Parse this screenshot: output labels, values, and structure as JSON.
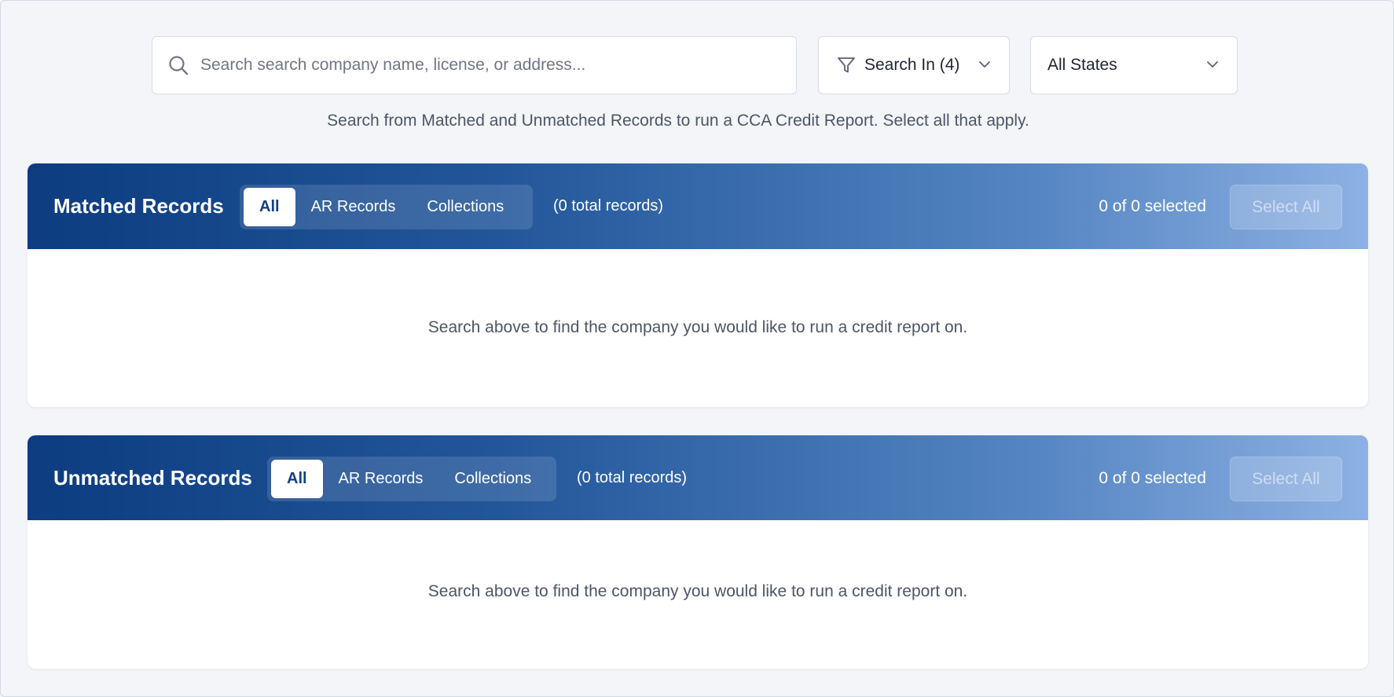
{
  "search": {
    "placeholder": "Search search company name, license, or address...",
    "value": ""
  },
  "filter": {
    "label": "Search In (4)",
    "icon": "filter-icon"
  },
  "state_select": {
    "selected": "All States"
  },
  "hint": "Search from Matched and Unmatched Records to run a CCA Credit Report. Select all that apply.",
  "matched": {
    "title": "Matched Records",
    "tabs": [
      "All",
      "AR Records",
      "Collections"
    ],
    "active_tab": "All",
    "total": "(0 total records)",
    "selected": "0 of 0 selected",
    "select_all": "Select All",
    "empty": "Search above to find the company you would like to run a credit report on."
  },
  "unmatched": {
    "title": "Unmatched Records",
    "tabs": [
      "All",
      "AR Records",
      "Collections"
    ],
    "active_tab": "All",
    "total": "(0 total records)",
    "selected": "0 of 0 selected",
    "select_all": "Select All",
    "empty": "Search above to find the company you would like to run a credit report on."
  },
  "colors": {
    "header_start": "#0d3c80",
    "header_end": "#8db1e4",
    "page_bg": "#f3f5f9",
    "active_tab_text": "#123f82"
  }
}
